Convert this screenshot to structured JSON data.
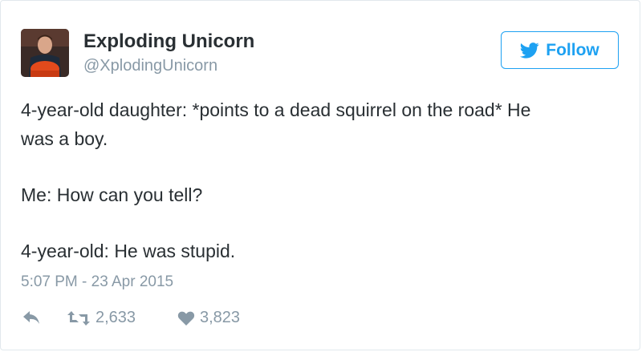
{
  "user": {
    "display_name": "Exploding Unicorn",
    "handle": "@XplodingUnicorn"
  },
  "follow_button": {
    "label": "Follow",
    "icon": "twitter-bird-icon",
    "color": "#1da1f2"
  },
  "tweet": {
    "lines": [
      "4-year-old daughter: *points to a dead squirrel on the road* He",
      "was a boy.",
      "Me: How can you tell?",
      "4-year-old: He was stupid."
    ],
    "timestamp": "5:07 PM - 23 Apr 2015"
  },
  "actions": {
    "reply_icon": "reply-icon",
    "retweet_icon": "retweet-icon",
    "retweet_count": "2,633",
    "like_icon": "heart-icon",
    "like_count": "3,823"
  }
}
